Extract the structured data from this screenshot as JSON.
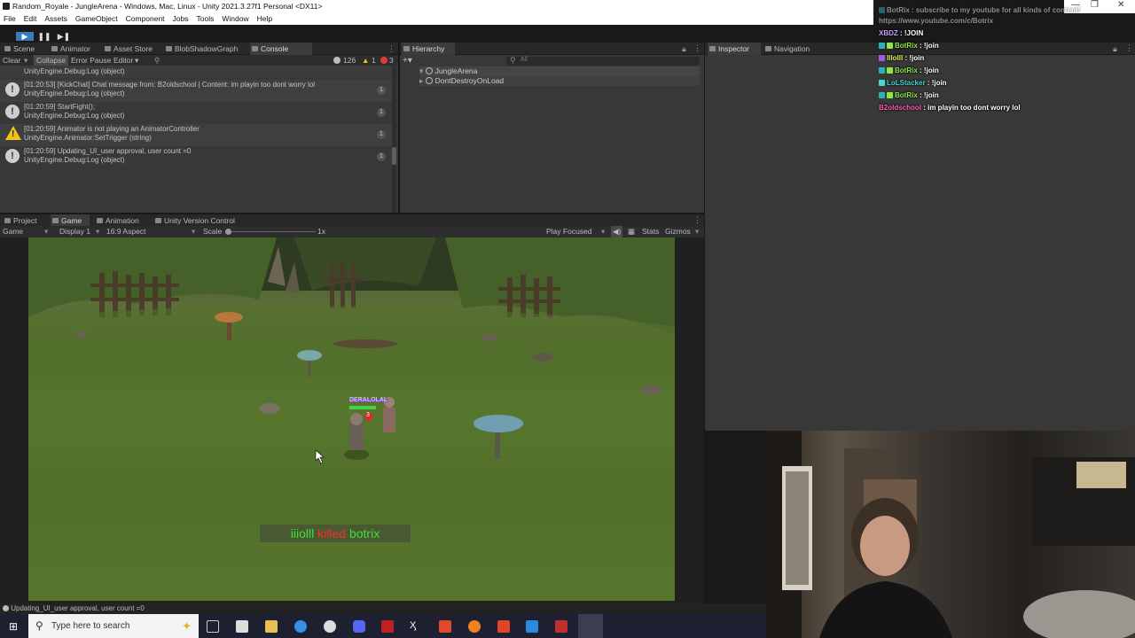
{
  "window": {
    "title": "Random_Royale - JungleArena - Windows, Mac, Linux - Unity 2021.3.27f1 Personal <DX11>",
    "controls": [
      "—",
      "❐",
      "✕"
    ]
  },
  "menu": [
    "File",
    "Edit",
    "Assets",
    "GameObject",
    "Component",
    "Jobs",
    "Tools",
    "Window",
    "Help"
  ],
  "playbar": {
    "play": "▶",
    "pause": "❚❚",
    "step": "▶❚"
  },
  "top_tabs": {
    "items": [
      "Scene",
      "Animator",
      "Asset Store",
      "BlobShadowGraph",
      "Console"
    ],
    "active": "Console"
  },
  "console": {
    "clear": "Clear",
    "collapse": "Collapse",
    "error_pause": "Error Pause",
    "editor": "Editor",
    "counts": {
      "info": "126",
      "warn": "1",
      "error": "3"
    },
    "partial_row": "UnityEngine.Debug:Log (object)",
    "rows": [
      {
        "type": "info",
        "line1": "[01:20:53] [KickChat] Chat message from: B2oldschool | Content: im playin too dont worry lol",
        "line2": "UnityEngine.Debug:Log (object)",
        "count": "1"
      },
      {
        "type": "info",
        "line1": "[01:20:59] StartFight();",
        "line2": "UnityEngine.Debug:Log (object)",
        "count": "1"
      },
      {
        "type": "warn",
        "line1": "[01:20:59] Animator is not playing an AnimatorController",
        "line2": "UnityEngine.Animator:SetTrigger (string)",
        "count": "1"
      },
      {
        "type": "info",
        "line1": "[01:20:59] Updating_UI_user approval, user count =0",
        "line2": "UnityEngine.Debug:Log (object)",
        "count": "1"
      }
    ]
  },
  "hierarchy": {
    "tab": "Hierarchy",
    "search_placeholder": "All",
    "items": [
      "JungleArena",
      "DontDestroyOnLoad"
    ]
  },
  "inspector": {
    "tabs": [
      "Inspector",
      "Navigation"
    ]
  },
  "bottom_tabs": {
    "items": [
      "Project",
      "Game",
      "Animation",
      "Unity Version Control"
    ],
    "active": "Game"
  },
  "game_toolbar": {
    "view": "Game",
    "display": "Display 1",
    "aspect": "16:9 Aspect",
    "scale_label": "Scale",
    "scale_value": "1x",
    "play_mode": "Play Focused",
    "stats": "Stats",
    "gizmos": "Gizmos"
  },
  "game": {
    "player_tag": "DERALOLAL",
    "player_number": "3",
    "killfeed": {
      "killer": "iiiolll",
      "verb": "killed",
      "victim": "botrix"
    }
  },
  "status_bar": "Updating_UI_user approval, user count =0",
  "chat": {
    "header": [
      "BotRix : subscribe to my youtube for all kinds of content!",
      "https://www.youtube.com/c/Botrix"
    ],
    "messages": [
      {
        "user": "XBDZ",
        "text": "!JOIN",
        "color": "#c8a0ff",
        "badge": false
      },
      {
        "user": "BotRix",
        "text": "!join",
        "color": "#8ee84a",
        "badge": true
      },
      {
        "user": "Illolll",
        "text": "!join",
        "color": "#d9f04b",
        "badge": true
      },
      {
        "user": "BotRix",
        "text": "!join",
        "color": "#8ee84a",
        "badge": true
      },
      {
        "user": "LoLStacker",
        "text": "!join",
        "color": "#49d4d4",
        "badge": true
      },
      {
        "user": "BotRix",
        "text": "!join",
        "color": "#8ee84a",
        "badge": true
      },
      {
        "user": "B2oldschool",
        "text": "im playin too dont worry lol",
        "color": "#ff5fb0",
        "badge": false
      }
    ]
  },
  "taskbar": {
    "search_placeholder": "Type here to search"
  },
  "colors": {
    "panel": "#383838",
    "tabbar": "#282828",
    "play_active": "#3a79bb",
    "warn": "#f1c21b",
    "error": "#e03b3b",
    "killfeed_green": "#3ee03e",
    "killfeed_red": "#ff2a2a"
  }
}
